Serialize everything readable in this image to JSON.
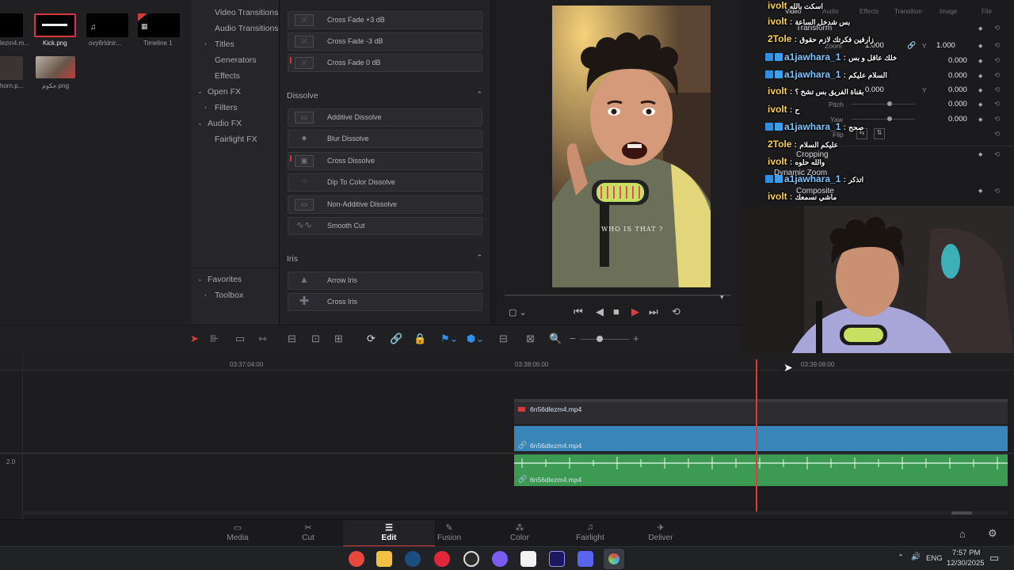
{
  "media_pool": {
    "clips": [
      {
        "name": "lezm4.m..."
      },
      {
        "name": "Kick.png"
      },
      {
        "name": "ovy6rldnir..."
      },
      {
        "name": "Timeline 1"
      },
      {
        "name": "horn.p..."
      },
      {
        "name": "حكوم.png"
      }
    ]
  },
  "effects_tree": {
    "items": [
      "Video Transitions",
      "Audio Transitions",
      "Titles",
      "Generators",
      "Effects",
      "Open FX",
      "Filters",
      "Audio FX",
      "Fairlight FX",
      "Favorites",
      "Toolbox"
    ]
  },
  "transitions": {
    "crossfade_items": [
      "Cross Fade +3 dB",
      "Cross Fade -3 dB",
      "Cross Fade 0 dB"
    ],
    "dissolve_header": "Dissolve",
    "dissolve_items": [
      "Additive Dissolve",
      "Blur Dissolve",
      "Cross Dissolve",
      "Dip To Color Dissolve",
      "Non-Additive Dissolve",
      "Smooth Cut"
    ],
    "iris_header": "Iris",
    "iris_items": [
      "Arrow Iris",
      "Cross Iris"
    ]
  },
  "video": {
    "shirt_text": "WHO IS THAT ?"
  },
  "inspector": {
    "tabs": [
      "Video",
      "Audio",
      "Effects",
      "Transition",
      "Image",
      "File"
    ],
    "transform_title": "Transform",
    "zoom_label": "Zoom",
    "zoom_x": "1.000",
    "zoom_y": "1.000",
    "values": [
      "0.000",
      "0.000",
      "0.000",
      "0.000",
      "0.000",
      "0.000",
      "0.000"
    ],
    "pitch_label": "Pitch",
    "yaw_label": "Yaw",
    "flip_label": "Flip",
    "cropping_title": "Cropping",
    "dynamic_zoom_title": "Dynamic Zoom",
    "composite_title": "Composite"
  },
  "chat": [
    {
      "user": "ivolt",
      "message": "اسكت بالله",
      "color": "#ffd24a"
    },
    {
      "user": "ivolt",
      "message": "بس شدخل الساعة",
      "color": "#ffd24a"
    },
    {
      "user": "2Tole",
      "message": "زارفين فكرتك لازم حقوق",
      "color": "#ffd24a"
    },
    {
      "user": "a1jawhara_1",
      "message": "خلك عاقل و بس",
      "color": "#7fc8ff"
    },
    {
      "user": "a1jawhara_1",
      "message": "السلام عليكم",
      "color": "#7fc8ff"
    },
    {
      "user": "ivolt",
      "message": "بقناة الفريق بس تشخ ؟",
      "color": "#ffd24a"
    },
    {
      "user": "ivolt",
      "message": "ح",
      "color": "#ffd24a"
    },
    {
      "user": "a1jawhara_1",
      "message": "صحح",
      "color": "#7fc8ff"
    },
    {
      "user": "2Tole",
      "message": "عليكم السلام",
      "color": "#ffd24a"
    },
    {
      "user": "ivolt",
      "message": "والله حلوه",
      "color": "#ffd24a"
    },
    {
      "user": "a1jawhara_1",
      "message": "اتذكر",
      "color": "#7fc8ff"
    },
    {
      "user": "ivolt",
      "message": "ماشي نسمعك",
      "color": "#ffd24a"
    }
  ],
  "timeline": {
    "timecodes": [
      "03:37:04:00",
      "03:38:06:00",
      "03:39:08:00"
    ],
    "track_level": "2.0",
    "clips": [
      {
        "name": "6n56dlezm4.mp4"
      },
      {
        "name": "6n56dlezm4.mp4"
      },
      {
        "name": "6n56dlezm4.mp4"
      }
    ]
  },
  "pages": [
    {
      "label": "Media"
    },
    {
      "label": "Cut"
    },
    {
      "label": "Edit"
    },
    {
      "label": "Fusion"
    },
    {
      "label": "Color"
    },
    {
      "label": "Fairlight"
    },
    {
      "label": "Deliver"
    }
  ],
  "active_page": "Edit",
  "taskbar": {
    "language": "ENG",
    "time": "7:57 PM",
    "date": "12/30/2025"
  },
  "colors": {
    "accent": "#d33b3b",
    "video_track": "#3a85b8",
    "audio_track": "#3c9a52"
  }
}
